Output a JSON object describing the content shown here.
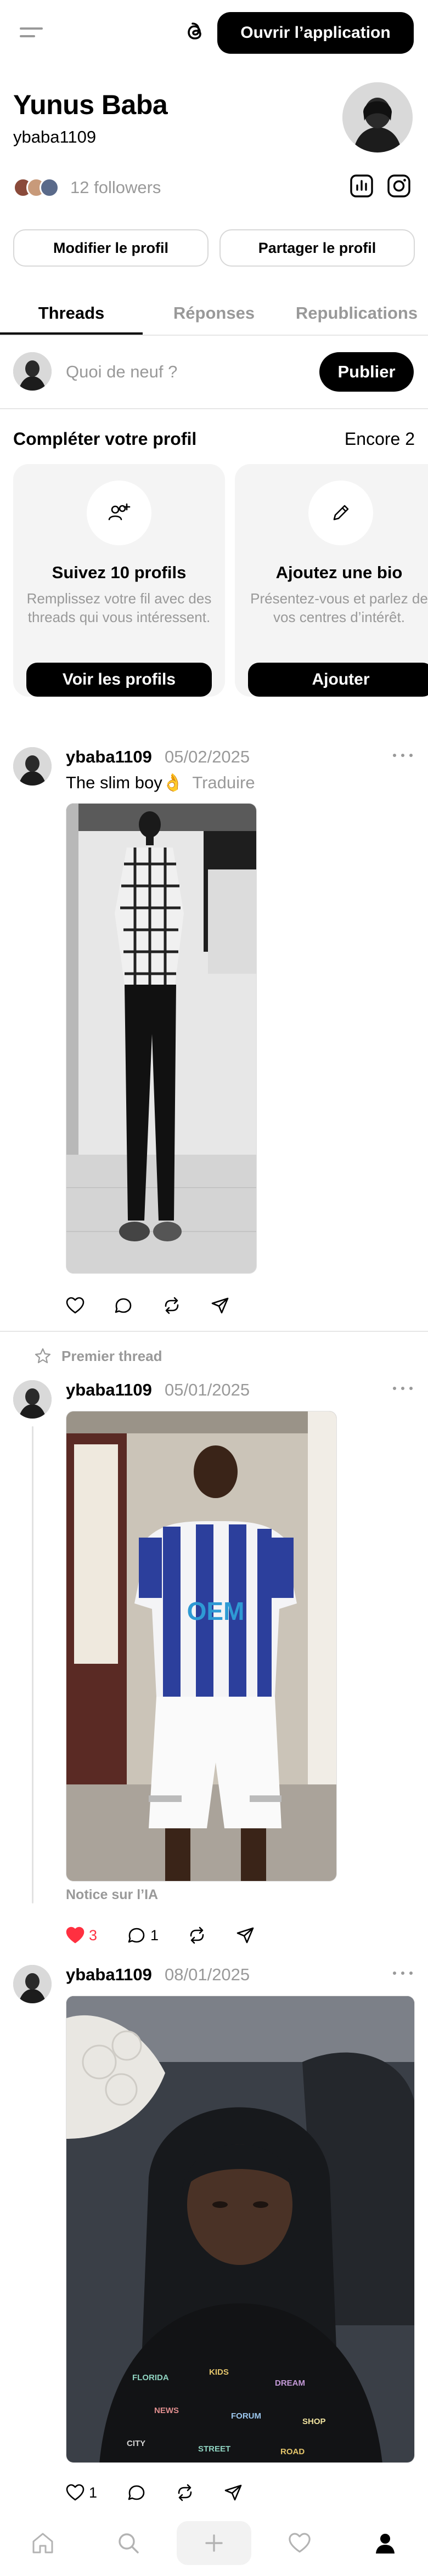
{
  "header": {
    "open_app_label": "Ouvrir l’application",
    "logo_icon": "threads-logo-icon",
    "menu_icon": "menu-icon"
  },
  "profile": {
    "name": "Yunus Baba",
    "handle": "ybaba1109",
    "followers_label": "12 followers",
    "edit_label": "Modifier le profil",
    "share_label": "Partager le profil"
  },
  "tabs": [
    {
      "label": "Threads",
      "active": true
    },
    {
      "label": "Réponses",
      "active": false
    },
    {
      "label": "Republications",
      "active": false
    }
  ],
  "composer": {
    "placeholder": "Quoi de neuf ?",
    "publish_label": "Publier"
  },
  "complete_profile": {
    "title": "Compléter votre profil",
    "remaining": "Encore 2",
    "cards": [
      {
        "title": "Suivez 10 profils",
        "description": "Remplissez votre fil avec des threads qui vous intéressent.",
        "button": "Voir les profils",
        "icon": "add-people-icon"
      },
      {
        "title": "Ajoutez une bio",
        "description": "Présentez-vous et parlez de vos centres d’intérêt.",
        "button": "Ajouter",
        "icon": "pencil-icon"
      }
    ]
  },
  "posts": [
    {
      "user": "ybaba1109",
      "date": "05/02/2025",
      "text": "The slim boy👌",
      "translate": "Traduire",
      "likes": "",
      "replies": ""
    },
    {
      "pinned_label": "Premier thread",
      "user": "ybaba1109",
      "date": "05/01/2025",
      "ai_notice": "Notice sur l’IA",
      "likes": "3",
      "replies": "1"
    },
    {
      "user": "ybaba1109",
      "date": "08/01/2025",
      "likes": "1",
      "replies": ""
    }
  ],
  "colors": {
    "accent": "#000000",
    "muted": "#999999",
    "like_red": "#ff3040",
    "card_bg": "#f4f4f4"
  }
}
